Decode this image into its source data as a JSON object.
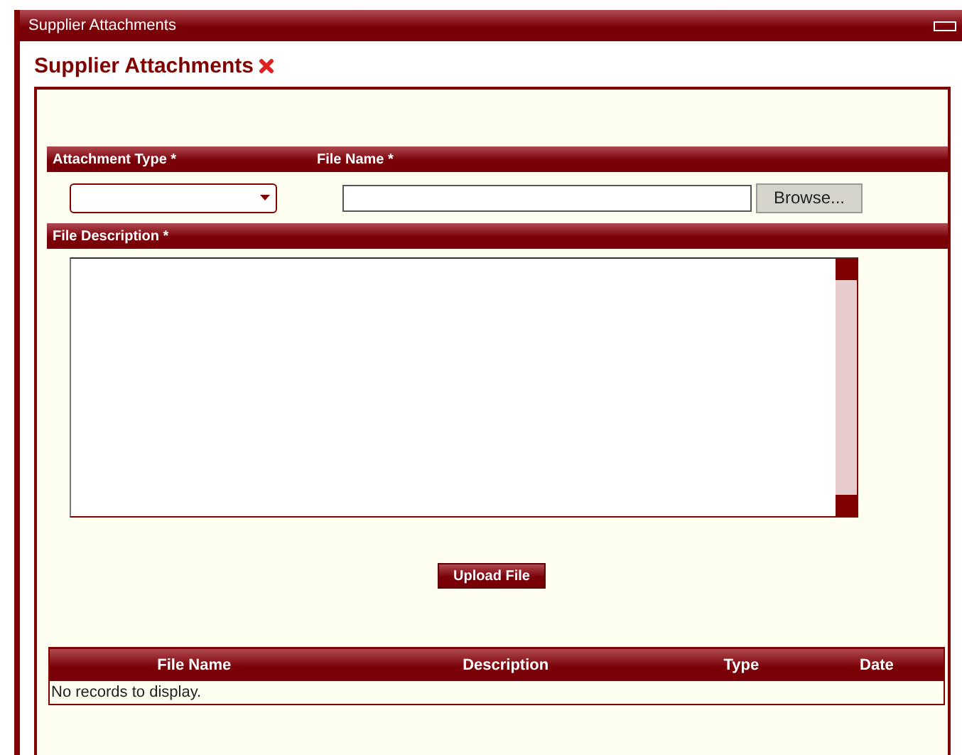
{
  "window": {
    "title": "Supplier Attachments"
  },
  "heading": "Supplier Attachments",
  "fields": [
    {
      "label": "Attachment Type",
      "required_mark": "*",
      "kind": "select"
    },
    {
      "label": "File Name",
      "required_mark": "*",
      "kind": "file",
      "button": "Browse..."
    }
  ],
  "description": {
    "label": "File Description",
    "required_mark": "*"
  },
  "upload_button": "Upload File",
  "table": {
    "columns": [
      "File Name",
      "Description",
      "Type",
      "Date"
    ],
    "empty_message": "No records to display."
  }
}
